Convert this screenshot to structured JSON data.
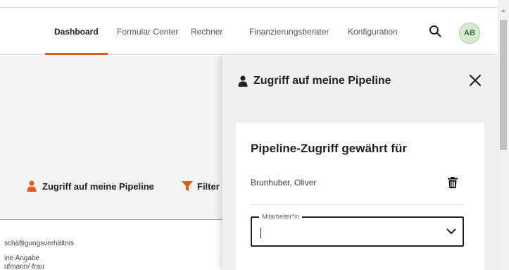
{
  "nav": {
    "items": [
      {
        "label": "Dashboard",
        "active": true
      },
      {
        "label": "Formular Center",
        "active": false
      },
      {
        "label": "Rechner",
        "active": false
      },
      {
        "label": "Finanzierungsberater",
        "active": false
      },
      {
        "label": "Konfiguration",
        "active": false
      }
    ],
    "avatar_initials": "AB",
    "accent_color": "#e8571e"
  },
  "background": {
    "pipeline_button": "Zugriff auf meine Pipeline",
    "filter_button": "Filter",
    "text_lines": [
      "schäftigungsverhältnis",
      "ine Angabe",
      "ufmann/-frau"
    ]
  },
  "panel": {
    "title": "Zugriff auf meine Pipeline",
    "card_title": "Pipeline-Zugriff gewährt für",
    "granted_users": [
      "Brunhuber, Oliver"
    ],
    "employee_field": {
      "label": "Mitarbeiter*in",
      "value": ""
    }
  },
  "icons": {
    "search": "search-icon",
    "close": "close-icon",
    "trash": "trash-icon",
    "person": "person-icon",
    "filter": "filter-icon",
    "chevron": "chevron-down-icon"
  }
}
